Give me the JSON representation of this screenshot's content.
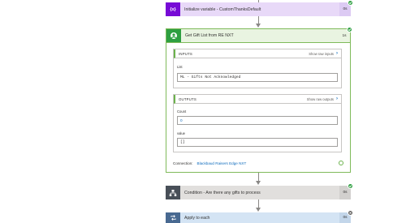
{
  "colors": {
    "variable_accent": "#770bd6",
    "success_green": "#2e9f41",
    "link_blue": "#0f6cbd",
    "condition_gray": "#484f58",
    "loop_blue": "#486991",
    "cancelled_gray": "#605e5c"
  },
  "steps": {
    "initialize_variable": {
      "title": "Initialize variable - CustomThanksDefault",
      "duration": "0s",
      "icon": "variable-braces-icon",
      "icon_glyph": "{x}",
      "status": "succeeded"
    },
    "get_gift_list": {
      "title": "Get Gift List from RE NXT",
      "duration": "1s",
      "icon": "blackbaud-connector-icon",
      "status": "succeeded",
      "inputs": {
        "label": "INPUTS",
        "show_raw": "Show raw inputs",
        "fields": [
          {
            "label": "List",
            "value": "ML - Gifts Not Acknowledged"
          }
        ]
      },
      "outputs": {
        "label": "OUTPUTS",
        "show_raw": "Show raw outputs",
        "fields": [
          {
            "label": "Count",
            "value": "0"
          },
          {
            "label": "value",
            "value": "[]"
          }
        ]
      },
      "connection_label": "Connection:",
      "connection_name": "Blackbaud Raisers Edge NXT"
    },
    "condition": {
      "title": "Condition - Are there any gifts to process",
      "duration": "0s",
      "icon": "condition-icon",
      "status": "succeeded"
    },
    "apply_to_each": {
      "title": "Apply to each",
      "duration": "0s",
      "icon": "loop-icon",
      "status": "cancelled"
    }
  }
}
